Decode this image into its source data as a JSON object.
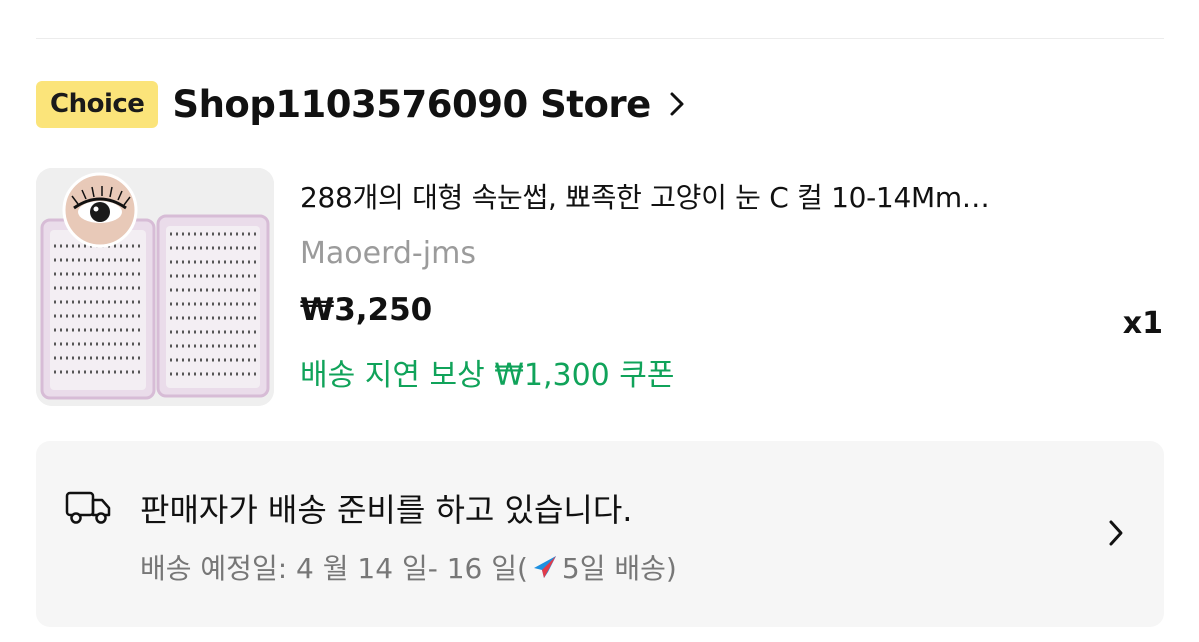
{
  "store": {
    "badge": "Choice",
    "name": "Shop1103576090 Store"
  },
  "product": {
    "title": "288개의 대형 속눈썹, 뾰족한 고양이 눈 C 컬 10-14Mm…",
    "seller": "Maoerd-jms",
    "price": "₩3,250",
    "coupon": "배송 지연 보상 ₩1,300 쿠폰",
    "quantity": "x1"
  },
  "shipping": {
    "status": "판매자가 배송 준비를 하고 있습니다.",
    "estimate_prefix": "배송 예정일: 4 월 14 일- 16 일(",
    "estimate_suffix": "5일 배송)"
  },
  "colors": {
    "badge_bg": "#fbe47a",
    "coupon_green": "#10a35a",
    "card_bg": "#f6f6f6"
  },
  "icons": {
    "store": "chevron-right-icon",
    "shipping": "truck-icon",
    "speed": "airplane-icon",
    "card": "chevron-right-icon"
  }
}
